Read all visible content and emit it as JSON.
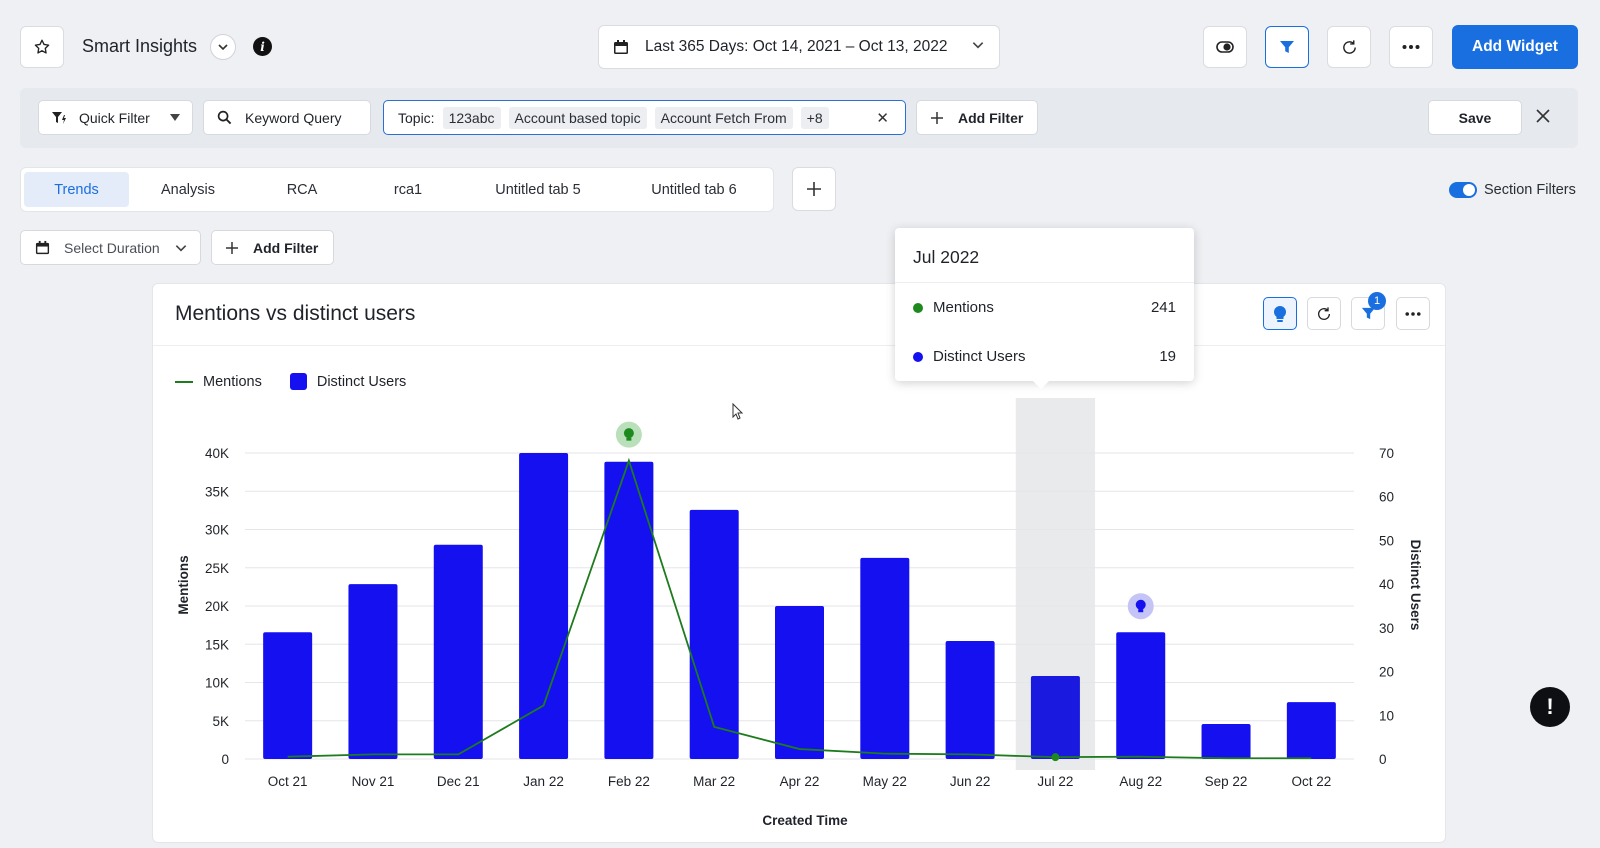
{
  "header": {
    "title": "Smart Insights",
    "date_range": "Last 365 Days: Oct 14, 2021 – Oct 13, 2022",
    "add_widget": "Add Widget"
  },
  "filters": {
    "quick_filter": "Quick Filter",
    "keyword_query": "Keyword Query",
    "topic_label": "Topic:",
    "topic_chips": [
      "123abc",
      "Account based topic",
      "Account Fetch From",
      "+8"
    ],
    "add_filter": "Add Filter",
    "save": "Save"
  },
  "tabs": [
    "Trends",
    "Analysis",
    "RCA",
    "rca1",
    "Untitled tab 5",
    "Untitled tab 6"
  ],
  "active_tab": "Trends",
  "section_filters": {
    "label": "Section Filters",
    "enabled": true
  },
  "section": {
    "select_duration": "Select Duration",
    "add_filter": "Add Filter"
  },
  "widget": {
    "title": "Mentions vs distinct users",
    "filter_badge": "1"
  },
  "tooltip": {
    "title": "Jul 2022",
    "rows": [
      {
        "label": "Mentions",
        "value": "241",
        "color": "#1e8a1e"
      },
      {
        "label": "Distinct Users",
        "value": "19",
        "color": "#1410f0"
      }
    ]
  },
  "colors": {
    "accent": "#1a6fe0",
    "bar": "#1410f0",
    "line": "#1e7b1e"
  },
  "chart_data": {
    "type": "bar",
    "categories": [
      "Oct 21",
      "Nov 21",
      "Dec 21",
      "Jan 22",
      "Feb 22",
      "Mar 22",
      "Apr 22",
      "May 22",
      "Jun 22",
      "Jul 22",
      "Aug 22",
      "Sep 22",
      "Oct 22"
    ],
    "series": [
      {
        "name": "Distinct Users",
        "axis": "right",
        "type": "bar",
        "values": [
          29,
          40,
          49,
          70,
          68,
          57,
          35,
          46,
          27,
          19,
          29,
          8,
          13
        ]
      },
      {
        "name": "Mentions",
        "axis": "left",
        "type": "line",
        "values": [
          300,
          600,
          600,
          7000,
          39000,
          4200,
          1300,
          700,
          600,
          241,
          300,
          100,
          100
        ]
      }
    ],
    "xlabel": "Created Time",
    "ylabel": "Mentions",
    "y2label": "Distinct Users",
    "y_ticks": [
      "0",
      "5K",
      "10K",
      "15K",
      "20K",
      "25K",
      "30K",
      "35K",
      "40K"
    ],
    "y2_ticks": [
      "0",
      "10",
      "20",
      "30",
      "40",
      "50",
      "60",
      "70"
    ],
    "ylim": [
      0,
      40000
    ],
    "y2lim": [
      0,
      70
    ],
    "highlighted_category": "Jul 22",
    "insight_markers": [
      {
        "category": "Feb 22",
        "series": "Mentions"
      },
      {
        "category": "Aug 22",
        "series": "Distinct Users"
      }
    ],
    "legend": "top-left",
    "grid": true
  }
}
